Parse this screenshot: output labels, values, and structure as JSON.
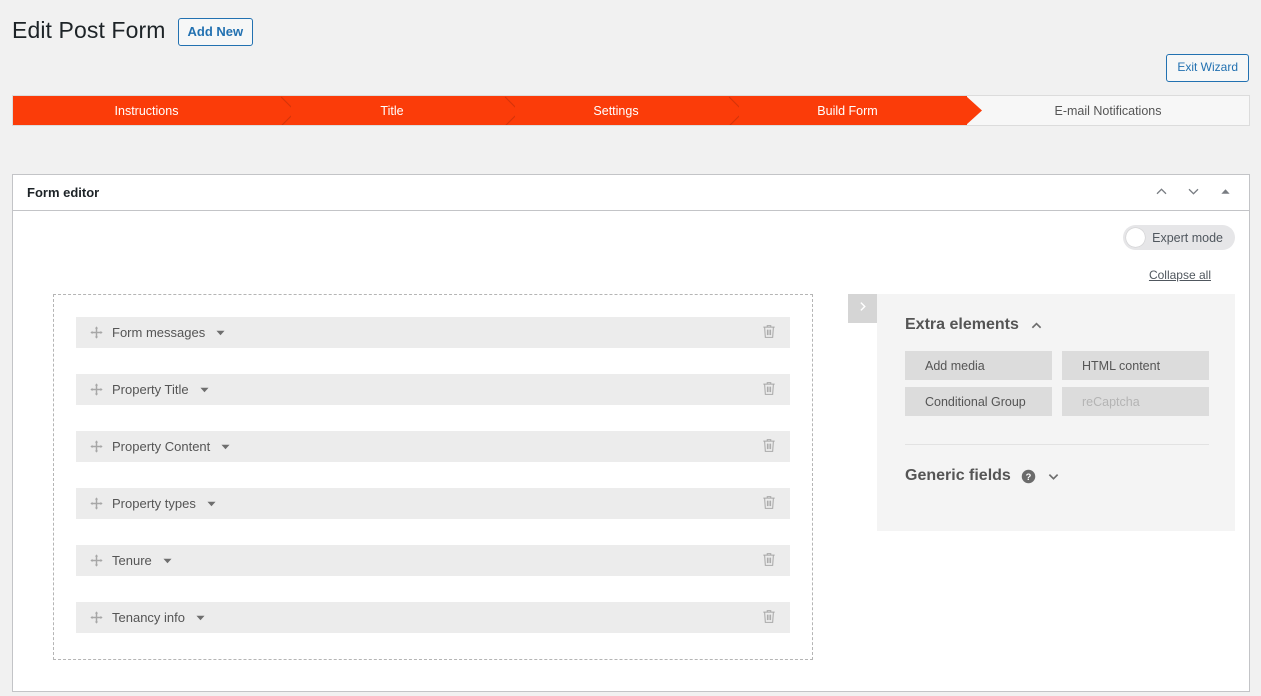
{
  "header": {
    "title": "Edit Post Form",
    "add_new_label": "Add New",
    "exit_wizard_label": "Exit Wizard"
  },
  "wizard": {
    "steps": [
      {
        "label": "Instructions",
        "state": "done"
      },
      {
        "label": "Title",
        "state": "done"
      },
      {
        "label": "Settings",
        "state": "done"
      },
      {
        "label": "Build Form",
        "state": "done"
      },
      {
        "label": "E-mail Notifications",
        "state": "upcoming"
      }
    ],
    "active_color": "#fb3c09",
    "inactive_bg": "#f7f7f7"
  },
  "postbox": {
    "title": "Form editor",
    "move_up_icon": "chevron-up-icon",
    "move_down_icon": "chevron-down-icon",
    "toggle_icon": "triangle-up-icon"
  },
  "toolbar": {
    "expert_mode_label": "Expert mode",
    "expert_mode_on": false,
    "collapse_all_label": "Collapse all"
  },
  "dropzone": {
    "fields": [
      {
        "label": "Form messages"
      },
      {
        "label": "Property Title"
      },
      {
        "label": "Property Content"
      },
      {
        "label": "Property types"
      },
      {
        "label": "Tenure"
      },
      {
        "label": "Tenancy info"
      }
    ],
    "move_icon": "move-arrows-icon",
    "caret_icon": "caret-down-icon",
    "delete_icon": "trash-icon"
  },
  "sidebar": {
    "handle_icon": "chevron-right-icon",
    "extra_elements": {
      "title": "Extra elements",
      "collapse_icon": "chevron-up-icon",
      "buttons": [
        {
          "label": "Add media",
          "disabled": false
        },
        {
          "label": "HTML content",
          "disabled": false
        },
        {
          "label": "Conditional Group",
          "disabled": false
        },
        {
          "label": "reCaptcha",
          "disabled": true
        }
      ]
    },
    "generic_fields": {
      "title": "Generic fields",
      "help_icon": "help-circle-icon",
      "expand_icon": "chevron-down-icon"
    }
  }
}
